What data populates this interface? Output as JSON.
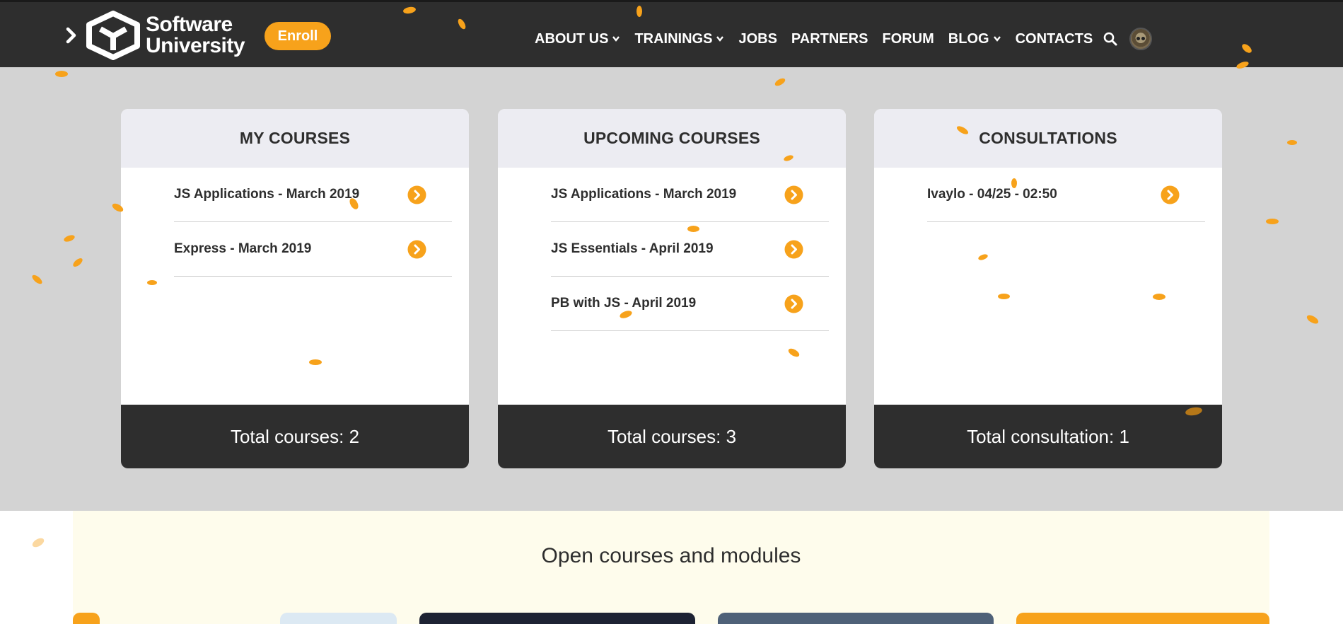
{
  "header": {
    "logo": {
      "line1": "Software",
      "line2": "University"
    },
    "enroll_label": "Enroll",
    "nav": [
      {
        "label": "ABOUT US",
        "dropdown": true
      },
      {
        "label": "TRAININGS",
        "dropdown": true
      },
      {
        "label": "JOBS",
        "dropdown": false
      },
      {
        "label": "PARTNERS",
        "dropdown": false
      },
      {
        "label": "FORUM",
        "dropdown": false
      },
      {
        "label": "BLOG",
        "dropdown": true
      },
      {
        "label": "CONTACTS",
        "dropdown": false
      }
    ]
  },
  "cards": [
    {
      "title": "MY COURSES",
      "items": [
        "JS Applications - March 2019",
        "Express - March 2019"
      ],
      "footer": "Total courses: 2"
    },
    {
      "title": "UPCOMING COURSES",
      "items": [
        "JS Applications - March 2019",
        "JS Essentials - April 2019",
        "PB with JS - April 2019"
      ],
      "footer": "Total courses: 3"
    },
    {
      "title": "CONSULTATIONS",
      "items": [
        "Ivaylo - 04/25 - 02:50"
      ],
      "footer": "Total consultation: 1"
    }
  ],
  "open_section": {
    "title": "Open courses and modules"
  },
  "colors": {
    "accent": "#f7a21b",
    "dark": "#2e2e2e",
    "page_bg": "#d3d3d3",
    "card_head": "#ececf2"
  },
  "icons": [
    "logo-chevron-icon",
    "logo-mark-icon",
    "chevron-down-icon",
    "search-icon",
    "arrow-right-circle-icon"
  ]
}
